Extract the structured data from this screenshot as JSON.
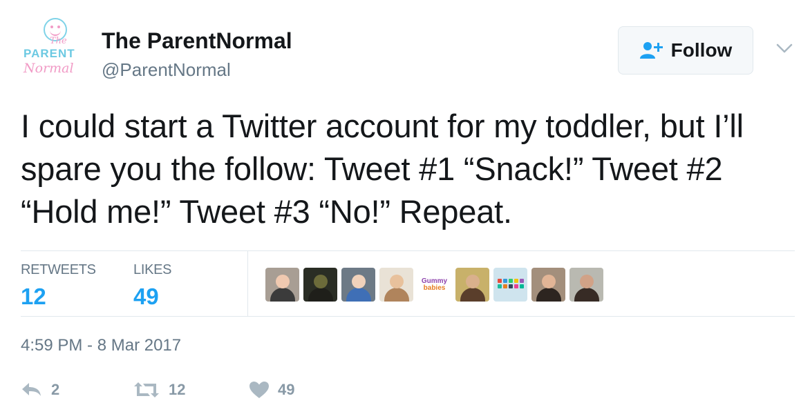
{
  "author": {
    "name": "The ParentNormal",
    "handle": "@ParentNormal",
    "avatar_logo": {
      "line1": "The",
      "line2": "PARENT",
      "line3": "Normal"
    }
  },
  "follow_button": {
    "label": "Follow",
    "icon": "add-user-icon"
  },
  "menu": {
    "icon": "chevron-down-icon"
  },
  "tweet": {
    "text": "I could start a Twitter account for my toddler, but I’ll spare you the follow: Tweet #1 “Snack!” Tweet #2 “Hold me!” Tweet #3 “No!” Repeat."
  },
  "stats": {
    "retweets_label": "RETWEETS",
    "retweets_value": "12",
    "likes_label": "LIKES",
    "likes_value": "49"
  },
  "likers": [
    {
      "kind": "photo",
      "bg": "#a89e94",
      "skin": "#f0c9b0",
      "shirt": "#3b3b3b"
    },
    {
      "kind": "photo",
      "bg": "#2a2d24",
      "skin": "#6c6b3a",
      "shirt": "#1f1f1a"
    },
    {
      "kind": "photo",
      "bg": "#6d7a86",
      "skin": "#f1d2bb",
      "shirt": "#3f6fb6"
    },
    {
      "kind": "photo",
      "bg": "#e9e2d6",
      "skin": "#e8c19c",
      "shirt": "#b0845c"
    },
    {
      "kind": "gummy",
      "line1": "Gummy",
      "line2": "babies"
    },
    {
      "kind": "photo",
      "bg": "#c8b16a",
      "skin": "#d9b08c",
      "shirt": "#5a3e2b"
    },
    {
      "kind": "icons"
    },
    {
      "kind": "photo",
      "bg": "#a38f7c",
      "skin": "#e2b596",
      "shirt": "#2d2520"
    },
    {
      "kind": "photo",
      "bg": "#b9b9b1",
      "skin": "#d1a287",
      "shirt": "#372b25"
    }
  ],
  "timestamp": "4:59 PM - 8 Mar 2017",
  "actions": {
    "reply_count": "2",
    "retweet_count": "12",
    "like_count": "49"
  },
  "colors": {
    "accent": "#1da1f2",
    "secondary_text": "#657786",
    "divider": "#e1e8ed",
    "action_icon": "#aab8c2"
  }
}
